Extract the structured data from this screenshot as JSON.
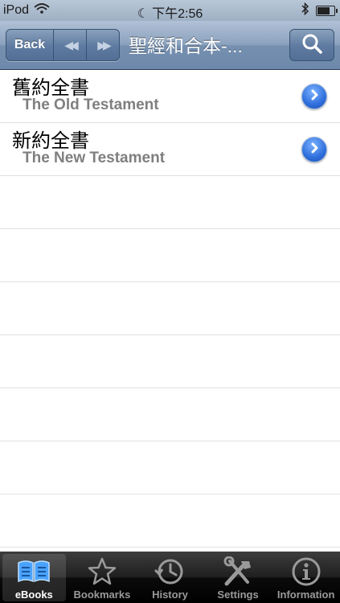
{
  "status_bar": {
    "carrier": "iPod",
    "time": "下午2:56"
  },
  "nav": {
    "back_label": "Back",
    "title": "聖經和合本-..."
  },
  "list": [
    {
      "title": "舊約全書",
      "subtitle": "The Old Testament"
    },
    {
      "title": "新約全書",
      "subtitle": "The New Testament"
    }
  ],
  "tabs": [
    {
      "label": "eBooks",
      "icon": "book-icon",
      "active": true
    },
    {
      "label": "Bookmarks",
      "icon": "star-icon",
      "active": false
    },
    {
      "label": "History",
      "icon": "clock-icon",
      "active": false
    },
    {
      "label": "Settings",
      "icon": "tools-icon",
      "active": false
    },
    {
      "label": "Information",
      "icon": "info-icon",
      "active": false
    }
  ],
  "colors": {
    "nav_bar": "#7690b0",
    "disclosure": "#2f6fdc",
    "tab_bar": "#000000",
    "active_tab_icon": "#4aa3ff"
  }
}
